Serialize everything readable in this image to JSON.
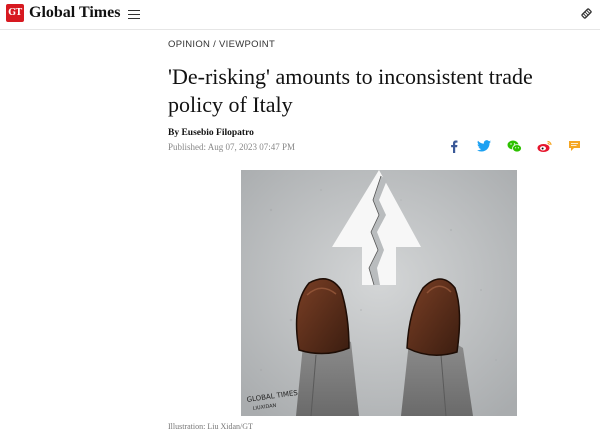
{
  "header": {
    "logo_mark": "GT",
    "logo_text": "Global Times"
  },
  "article": {
    "section": "OPINION / VIEWPOINT",
    "title": "'De-risking' amounts to inconsistent trade policy of Italy",
    "author": "By Eusebio Filopatro",
    "published": "Published: Aug 07, 2023 07:47 PM",
    "caption": "Illustration: Liu Xidan/GT",
    "illustration_signature": "GLOBAL TIMES LIUXIDAN"
  },
  "share": {
    "icons": [
      "facebook-icon",
      "twitter-icon",
      "wechat-icon",
      "weibo-icon",
      "comment-icon"
    ],
    "colors": {
      "facebook": "#3b5998",
      "twitter": "#1da1f2",
      "wechat": "#2dc100",
      "weibo": "#e6162d",
      "comment": "#f5a623"
    }
  },
  "colors": {
    "brand": "#d71920"
  }
}
